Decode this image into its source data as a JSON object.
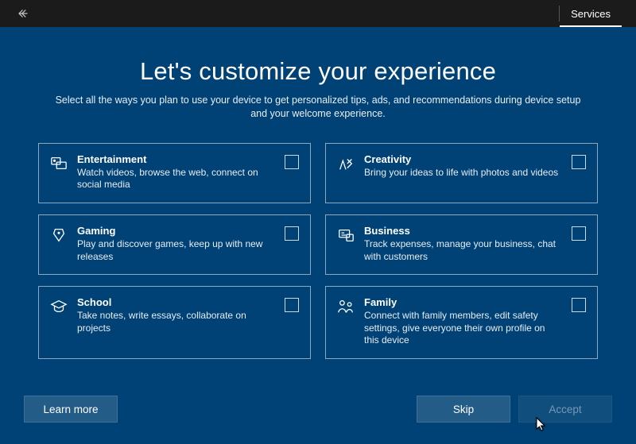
{
  "titlebar": {
    "tab_services": "Services"
  },
  "page": {
    "heading": "Let's customize your experience",
    "subtitle": "Select all the ways you plan to use your device to get personalized tips, ads, and recommendations during device setup and your welcome experience."
  },
  "cards": [
    {
      "icon": "entertainment",
      "title": "Entertainment",
      "desc": "Watch videos, browse the web, connect on social media"
    },
    {
      "icon": "creativity",
      "title": "Creativity",
      "desc": "Bring your ideas to life with photos and videos"
    },
    {
      "icon": "gaming",
      "title": "Gaming",
      "desc": "Play and discover games, keep up with new releases"
    },
    {
      "icon": "business",
      "title": "Business",
      "desc": "Track expenses, manage your business, chat with customers"
    },
    {
      "icon": "school",
      "title": "School",
      "desc": "Take notes, write essays, collaborate on projects"
    },
    {
      "icon": "family",
      "title": "Family",
      "desc": "Connect with family members, edit safety settings, give everyone their own profile on this device"
    }
  ],
  "footer": {
    "learn_more": "Learn more",
    "skip": "Skip",
    "accept": "Accept"
  }
}
